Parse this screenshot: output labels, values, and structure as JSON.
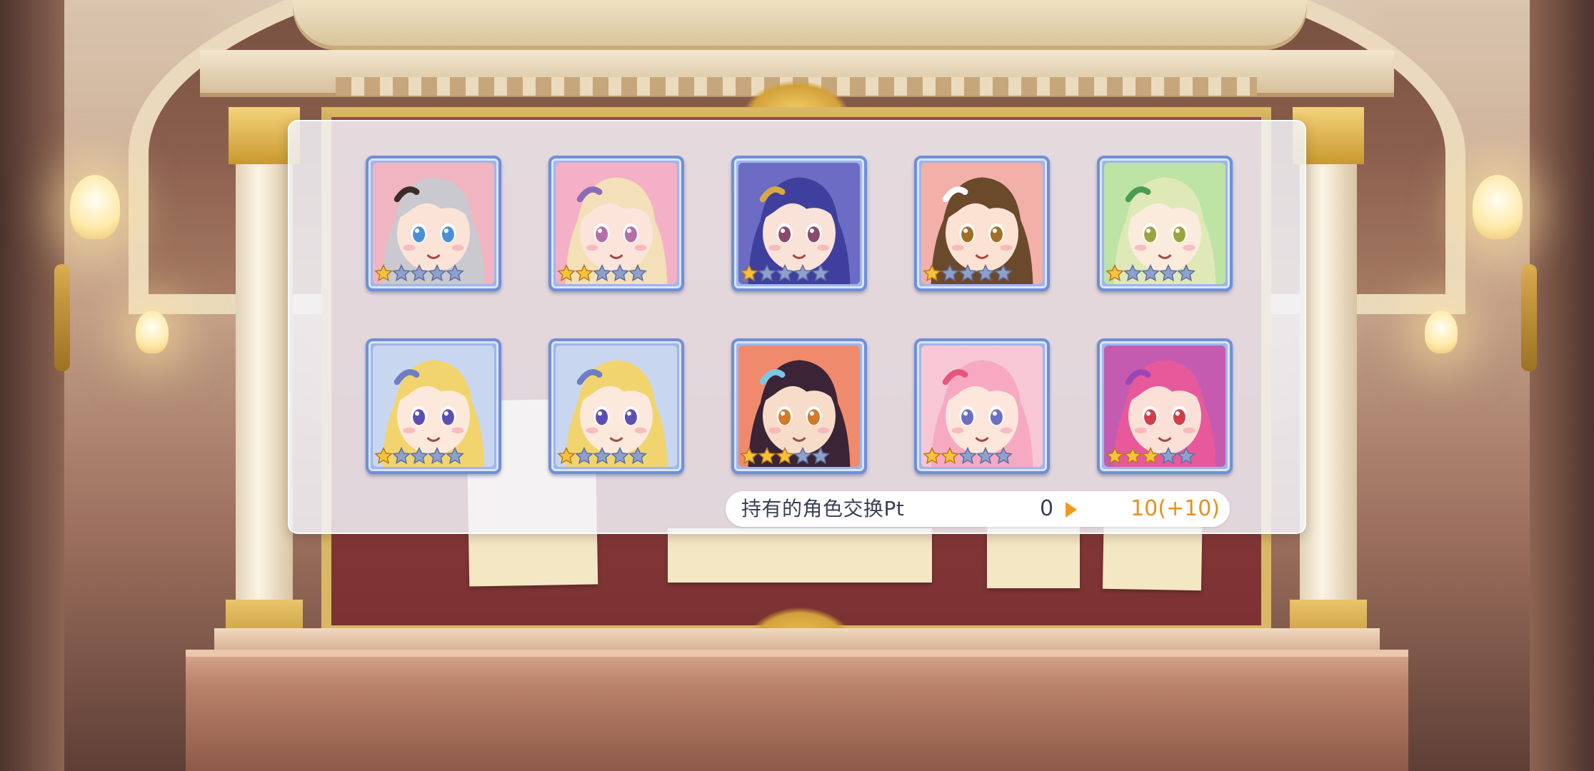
{
  "colors": {
    "panel_bg": "#f3f4fa",
    "card_border": "#6f8fd8",
    "star_filled": "#f6c23c",
    "star_empty": "#8ea0cc",
    "value_accent": "#e5901f"
  },
  "characters": [
    {
      "name": "character-1",
      "stars": 1,
      "max_stars": 5,
      "hair": "#c9c9cf",
      "skin": "#fbe3d8",
      "eyes": "#4b8fd6",
      "bg": "#f0b5c0",
      "accent": "#3a2e2a"
    },
    {
      "name": "character-2",
      "stars": 2,
      "max_stars": 5,
      "hair": "#f3dfb8",
      "skin": "#fbe4d9",
      "eyes": "#b36fa8",
      "bg": "#f4b0c6",
      "accent": "#8b6cb5"
    },
    {
      "name": "character-3",
      "stars": 1,
      "max_stars": 5,
      "hair": "#3f3f9e",
      "skin": "#f9e3d9",
      "eyes": "#8a4a6a",
      "bg": "#6c6cc4",
      "accent": "#d9a842"
    },
    {
      "name": "character-4",
      "stars": 1,
      "max_stars": 5,
      "hair": "#6b4a2c",
      "skin": "#fbe2d2",
      "eyes": "#a0702a",
      "bg": "#f2b0a8",
      "accent": "#ffffff"
    },
    {
      "name": "character-5",
      "stars": 1,
      "max_stars": 5,
      "hair": "#dfe9b8",
      "skin": "#fbebdd",
      "eyes": "#9aa540",
      "bg": "#bde3a5",
      "accent": "#4d9a52"
    },
    {
      "name": "character-6",
      "stars": 1,
      "max_stars": 5,
      "hair": "#f2d46e",
      "skin": "#fde8dc",
      "eyes": "#5b4fb3",
      "bg": "#c9d6f0",
      "accent": "#6d7fc4"
    },
    {
      "name": "character-7",
      "stars": 1,
      "max_stars": 5,
      "hair": "#f2d46e",
      "skin": "#fde8dc",
      "eyes": "#5b4fb3",
      "bg": "#c9d6f0",
      "accent": "#6d7fc4"
    },
    {
      "name": "character-8",
      "stars": 3,
      "max_stars": 5,
      "hair": "#3b2436",
      "skin": "#f7dcc9",
      "eyes": "#d07a2a",
      "bg": "#f08a6c",
      "accent": "#7ac8e8"
    },
    {
      "name": "character-9",
      "stars": 2,
      "max_stars": 5,
      "hair": "#f7a9c2",
      "skin": "#fde6dc",
      "eyes": "#6b6fc4",
      "bg": "#f7c7d6",
      "accent": "#e8557a"
    },
    {
      "name": "character-10",
      "stars": 3,
      "max_stars": 5,
      "hair": "#e8599b",
      "skin": "#fbe0d8",
      "eyes": "#d23d4a",
      "bg": "#c45bb0",
      "accent": "#9a47b5"
    }
  ],
  "points": {
    "label": "持有的角色交换Pt",
    "current": "0",
    "after": "10(+10)"
  }
}
